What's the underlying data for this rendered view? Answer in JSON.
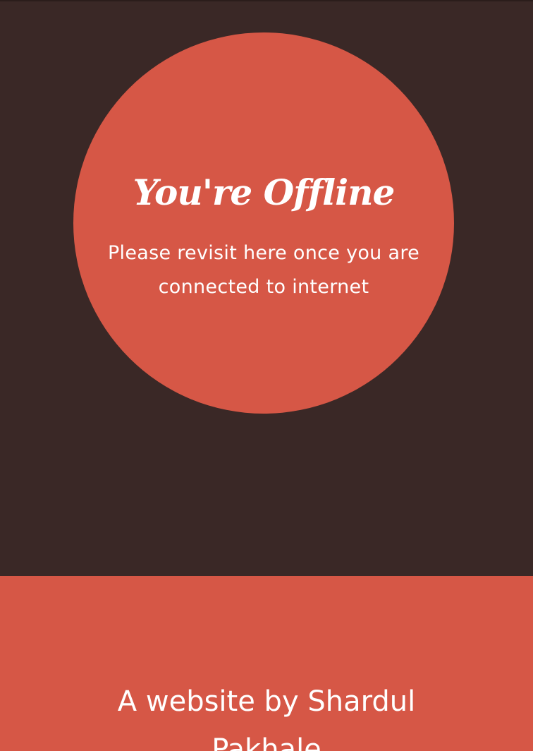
{
  "offline": {
    "title": "You're Offline",
    "message": "Please revisit here once you are connected to internet"
  },
  "footer": {
    "credit": "A website by Shardul Pakhale"
  },
  "colors": {
    "background": "#3a2826",
    "accent": "#d65746",
    "text": "#ffffff"
  }
}
